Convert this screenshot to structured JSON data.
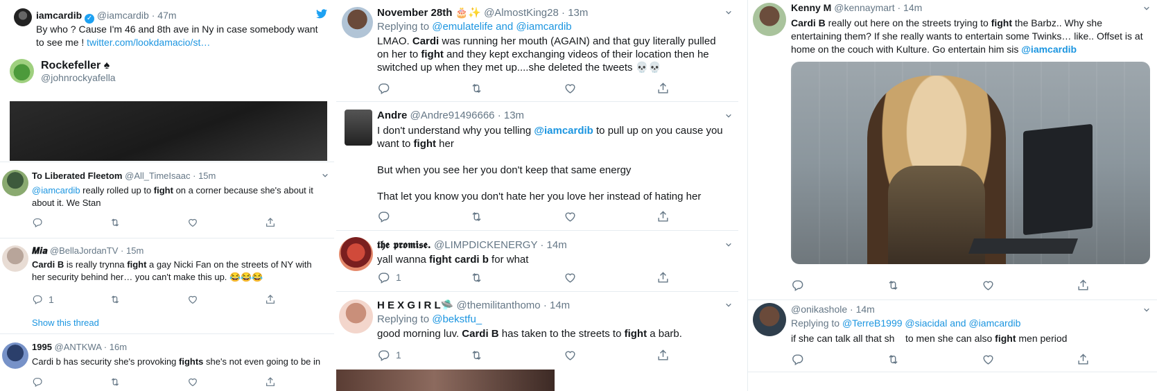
{
  "col1": {
    "quote": {
      "name": "iamcardib",
      "handle": "@iamcardib",
      "time": "47m",
      "text": "By who ? Cause I'm 46 and 8th ave in Ny in case somebody want to see me !",
      "link": "twitter.com/lookdamacio/st…",
      "inner_name": "Rockefeller",
      "inner_suit": "♠",
      "inner_handle": "@johnrockyafella"
    },
    "tweets": [
      {
        "name": "To Liberated Fleetom",
        "handle": "@All_TimeIsaac",
        "time": "15m",
        "mention": "@iamcardib",
        "text_a": " really rolled up to ",
        "bold": "fight",
        "text_b": " on a corner because she's about it about it. We Stan"
      },
      {
        "name": "𝑴𝒊𝒂",
        "handle": "@BellaJordanTV",
        "time": "15m",
        "bold1": "Cardi B",
        "text_a": " is really trynna ",
        "bold2": "fight",
        "text_b": " a gay Nicki Fan on the streets of NY with her security behind her… you can't make this up. 😂😂😂",
        "reply_count": "1",
        "show_thread": "Show this thread"
      },
      {
        "name": "1995",
        "handle": "@ANTKWA",
        "time": "16m",
        "text_a": "Cardi b has security she's provoking ",
        "bold": "fights",
        "text_b": " she's not even going to be in"
      }
    ]
  },
  "col2": {
    "tweets": [
      {
        "name": "November 28th 🎂✨",
        "handle": "@AlmostKing28",
        "time": "13m",
        "replying_label": "Replying to",
        "replying_a": "@emulatelife",
        "replying_and": "and",
        "replying_b": "@iamcardib",
        "t1": "LMAO. ",
        "b1": "Cardi",
        "t2": " was running her mouth (AGAIN) and that guy literally pulled on her to ",
        "b2": "fight",
        "t3": " and they kept exchanging videos of their location then he switched up when they met up....she deleted the tweets 💀💀"
      },
      {
        "name": "Andre",
        "handle": "@Andre91496666",
        "time": "13m",
        "t1": "I don't understand why you telling ",
        "mention": "@iamcardib",
        "t2": " to pull up on you cause you want to ",
        "b1": "fight",
        "t3": " her",
        "p2": "But when you see her you don't keep that same energy",
        "p3": "That let you know you don't hate her you love her instead of hating her"
      },
      {
        "name": "𝖙𝖍𝖊 𝖕𝖗𝖔𝖒𝖎𝖘𝖊.",
        "handle": "@LIMPDICKENERGY",
        "time": "14m",
        "t1": "yall wanna ",
        "b1": "fight cardi b",
        "t2": " for what",
        "reply_count": "1"
      },
      {
        "name": "H E X G I R L🛸",
        "handle": "@themilitanthomo",
        "time": "14m",
        "replying_label": "Replying to",
        "replying_a": "@bekstfu_",
        "t1": "good morning luv. ",
        "b1": "Cardi B",
        "t2": " has taken to the streets to ",
        "b2": "fight",
        "t3": " a barb.",
        "reply_count": "1"
      }
    ]
  },
  "col3": {
    "tweets": [
      {
        "name": "Kenny M",
        "handle": "@kennaymart",
        "time": "14m",
        "b1": "Cardi B",
        "t1": " really out here on the streets trying to ",
        "b2": "fight",
        "t2": " the Barbz.. Why she entertaining them? If she really wants to entertain some Twinks… like.. Offset is at home on the couch with Kulture. Go entertain him sis ",
        "mention": "@iamcardib"
      },
      {
        "handle": "@onikashole",
        "time": "14m",
        "replying_label": "Replying to",
        "replying_a": "@TerreB1999",
        "replying_b": "@siacidal",
        "replying_and": "and",
        "replying_c": "@iamcardib",
        "t1": "if she can talk all that sh    to men she can also ",
        "b1": "fight",
        "t2": " men period"
      }
    ]
  },
  "colors": {
    "link": "#1b95e0",
    "text": "#14171a",
    "muted": "#657786",
    "verified": "#1da1f2",
    "twitter_bird": "#1da1f2"
  },
  "icons": [
    "reply-icon",
    "retweet-icon",
    "like-icon",
    "share-icon",
    "chevron-down-icon",
    "verified-icon",
    "twitter-bird-icon"
  ]
}
